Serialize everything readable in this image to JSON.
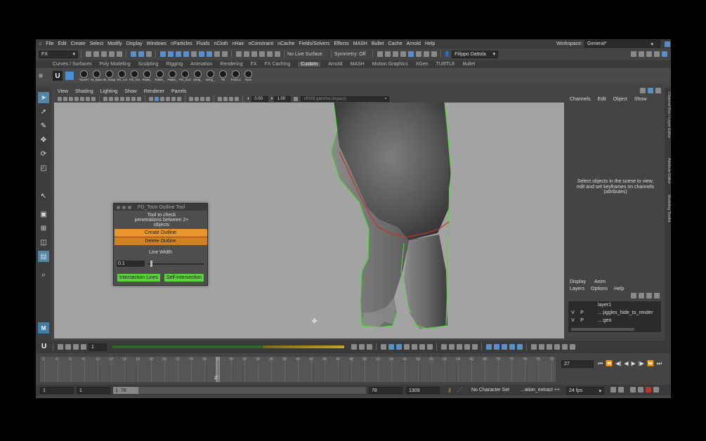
{
  "menubar": {
    "items": [
      "File",
      "Edit",
      "Create",
      "Select",
      "Modify",
      "Display",
      "Windows",
      "nParticles",
      "Fluids",
      "nCloth",
      "nHair",
      "nConstraint",
      "nCache",
      "Fields/Solvers",
      "Effects",
      "MASH",
      "Bullet",
      "Cache",
      "Arnold",
      "Help"
    ],
    "workspace_label": "Workspace:",
    "workspace_value": "General*"
  },
  "statusline": {
    "mode": "FX",
    "live_surface": "No Live Surface",
    "symmetry": "Symmetry: Off",
    "user": "Filippo Dattola"
  },
  "shelf": {
    "tabs": [
      "Curves / Surfaces",
      "Poly Modeling",
      "Sculpting",
      "Rigging",
      "Animation",
      "Rendering",
      "FX",
      "FX Caching",
      "Custom",
      "Arnold",
      "MASH",
      "Motion Graphics",
      "XGen",
      "TURTLE",
      "Bullet"
    ],
    "active_tab": "Custom",
    "icons": [
      "ToonTr",
      "M_Spac",
      "W_Snap",
      "FD_col",
      "FD_Tra",
      "Paste_",
      "Paste_",
      "Paste_",
      "FD_GUI",
      "temp_",
      "temp_",
      "TE",
      "TrckCo",
      "Toon"
    ]
  },
  "viewport": {
    "menu": [
      "View",
      "Shading",
      "Lighting",
      "Show",
      "Renderer",
      "Panels"
    ],
    "field_a": "0.00",
    "field_b": "1.00",
    "colorspace": "sRGB gamma (legacy)"
  },
  "channel_box": {
    "menu": [
      "Channels",
      "Edit",
      "Object",
      "Show"
    ],
    "message": "Select objects in the scene to view, edit and set keyframes on channels (attributes)"
  },
  "layers": {
    "tabs": [
      "Display",
      "Anim"
    ],
    "menu": [
      "Layers",
      "Options",
      "Help"
    ],
    "items": [
      {
        "v": "",
        "p": "",
        "name": "layer1"
      },
      {
        "v": "V",
        "p": "P",
        "name": "...:jiggles_hide_to_render"
      },
      {
        "v": "V",
        "p": "P",
        "name": "...:geo"
      }
    ]
  },
  "side_tabs": [
    "Channel Box / Layer Editor",
    "Attribute Editor",
    "Modeling Toolkit"
  ],
  "dialog": {
    "title": "FD_Toon Outline Tool",
    "description": "Tool to check penetrations between 2+ objects",
    "create_label": "Create Outline",
    "delete_label": "Delete Outline",
    "line_width_label": "Line Width",
    "line_width_value": "0.1",
    "intersection_label": "Intersection Lines",
    "self_intersection_label": "Self-intersection"
  },
  "timeline": {
    "step_value": "1",
    "ticks": [
      "2",
      "4",
      "6",
      "8",
      "10",
      "12",
      "14",
      "16",
      "18",
      "20",
      "22",
      "24",
      "26",
      "28",
      "30",
      "32",
      "34",
      "36",
      "38",
      "40",
      "42",
      "44",
      "46",
      "48",
      "50",
      "52",
      "54",
      "56",
      "58",
      "60",
      "62",
      "64",
      "66",
      "68",
      "70",
      "72",
      "74",
      "76",
      "78"
    ],
    "current_frame": "27",
    "current_field": "27"
  },
  "range": {
    "start": "1",
    "start_inner": "1",
    "slider_start": "1",
    "slider_end": "78",
    "end_inner": "78",
    "end": "1309",
    "character_set": "No Character Set",
    "anim_layer": "...ation_extract ++",
    "fps": "24 fps"
  }
}
